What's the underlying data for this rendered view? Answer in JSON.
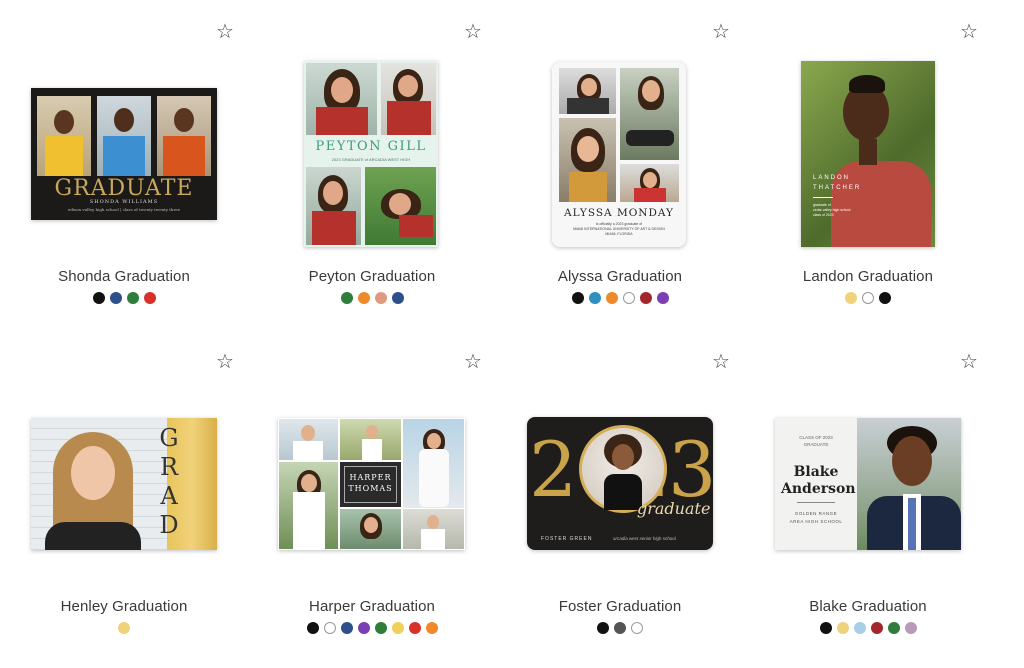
{
  "products": [
    {
      "name": "Shonda Graduation",
      "colors": [
        "#111111",
        "#2d4f8c",
        "#2e7d3a",
        "#d9302c"
      ],
      "card_text": {
        "big": "GRADUATE",
        "line1": "SHONDA WILLIAMS",
        "line2": "edison valley high school | class of twenty twenty three"
      }
    },
    {
      "name": "Peyton Graduation",
      "colors": [
        "#2e7d3a",
        "#ee8a2a",
        "#e09a82",
        "#2d4f8c"
      ],
      "card_text": {
        "big": "PEYTON GILL",
        "line1": "2023 GRADUATE of ARCADIA WEST HIGH"
      }
    },
    {
      "name": "Alyssa Graduation",
      "colors": [
        "#111111",
        "#2f8fbf",
        "#ee8a2a",
        "#ffffff",
        "#a3262c",
        "#7a3fb0"
      ],
      "card_text": {
        "big": "ALYSSA MONDAY",
        "line1": "is officially a 2023 graduate of",
        "line2": "MIAMI INTERNATIONAL UNIVERSITY OF ART & DESIGN",
        "line3": "MIAMI, FLORIDA"
      }
    },
    {
      "name": "Landon Graduation",
      "colors": [
        "#efd27a",
        "#ffffff",
        "#111111"
      ],
      "card_text": {
        "big": "LANDON THATCHER",
        "line1": "graduate of",
        "line2": "cedar valley high school",
        "line3": "class of 2023"
      }
    },
    {
      "name": "Henley Graduation",
      "colors": [
        "#efd27a"
      ],
      "card_text": {
        "big": "GRAD"
      }
    },
    {
      "name": "Harper Graduation",
      "colors": [
        "#111111",
        "#ffffff",
        "#2d4f8c",
        "#7a3fb0",
        "#2e7d3a",
        "#efd05a",
        "#d9302c",
        "#ee8a2a"
      ],
      "card_text": {
        "big": "HARPER THOMAS"
      }
    },
    {
      "name": "Foster Graduation",
      "colors": [
        "#111111",
        "#555555",
        "#ffffff"
      ],
      "card_text": {
        "big": "2023",
        "script": "graduate",
        "line1": "FOSTER GREEN",
        "line2": "arcadia west senior high school"
      }
    },
    {
      "name": "Blake Graduation",
      "colors": [
        "#111111",
        "#efd27a",
        "#a8cfe6",
        "#a3262c",
        "#2e7d3a",
        "#b99ab8"
      ],
      "card_text": {
        "line0": "CLASS OF 2023 GRADUATE",
        "big": "Blake Anderson",
        "line1": "GOLDEN RANGE AREA HIGH SCHOOL"
      }
    }
  ],
  "icons": {
    "favorite": "star-outline-icon"
  }
}
